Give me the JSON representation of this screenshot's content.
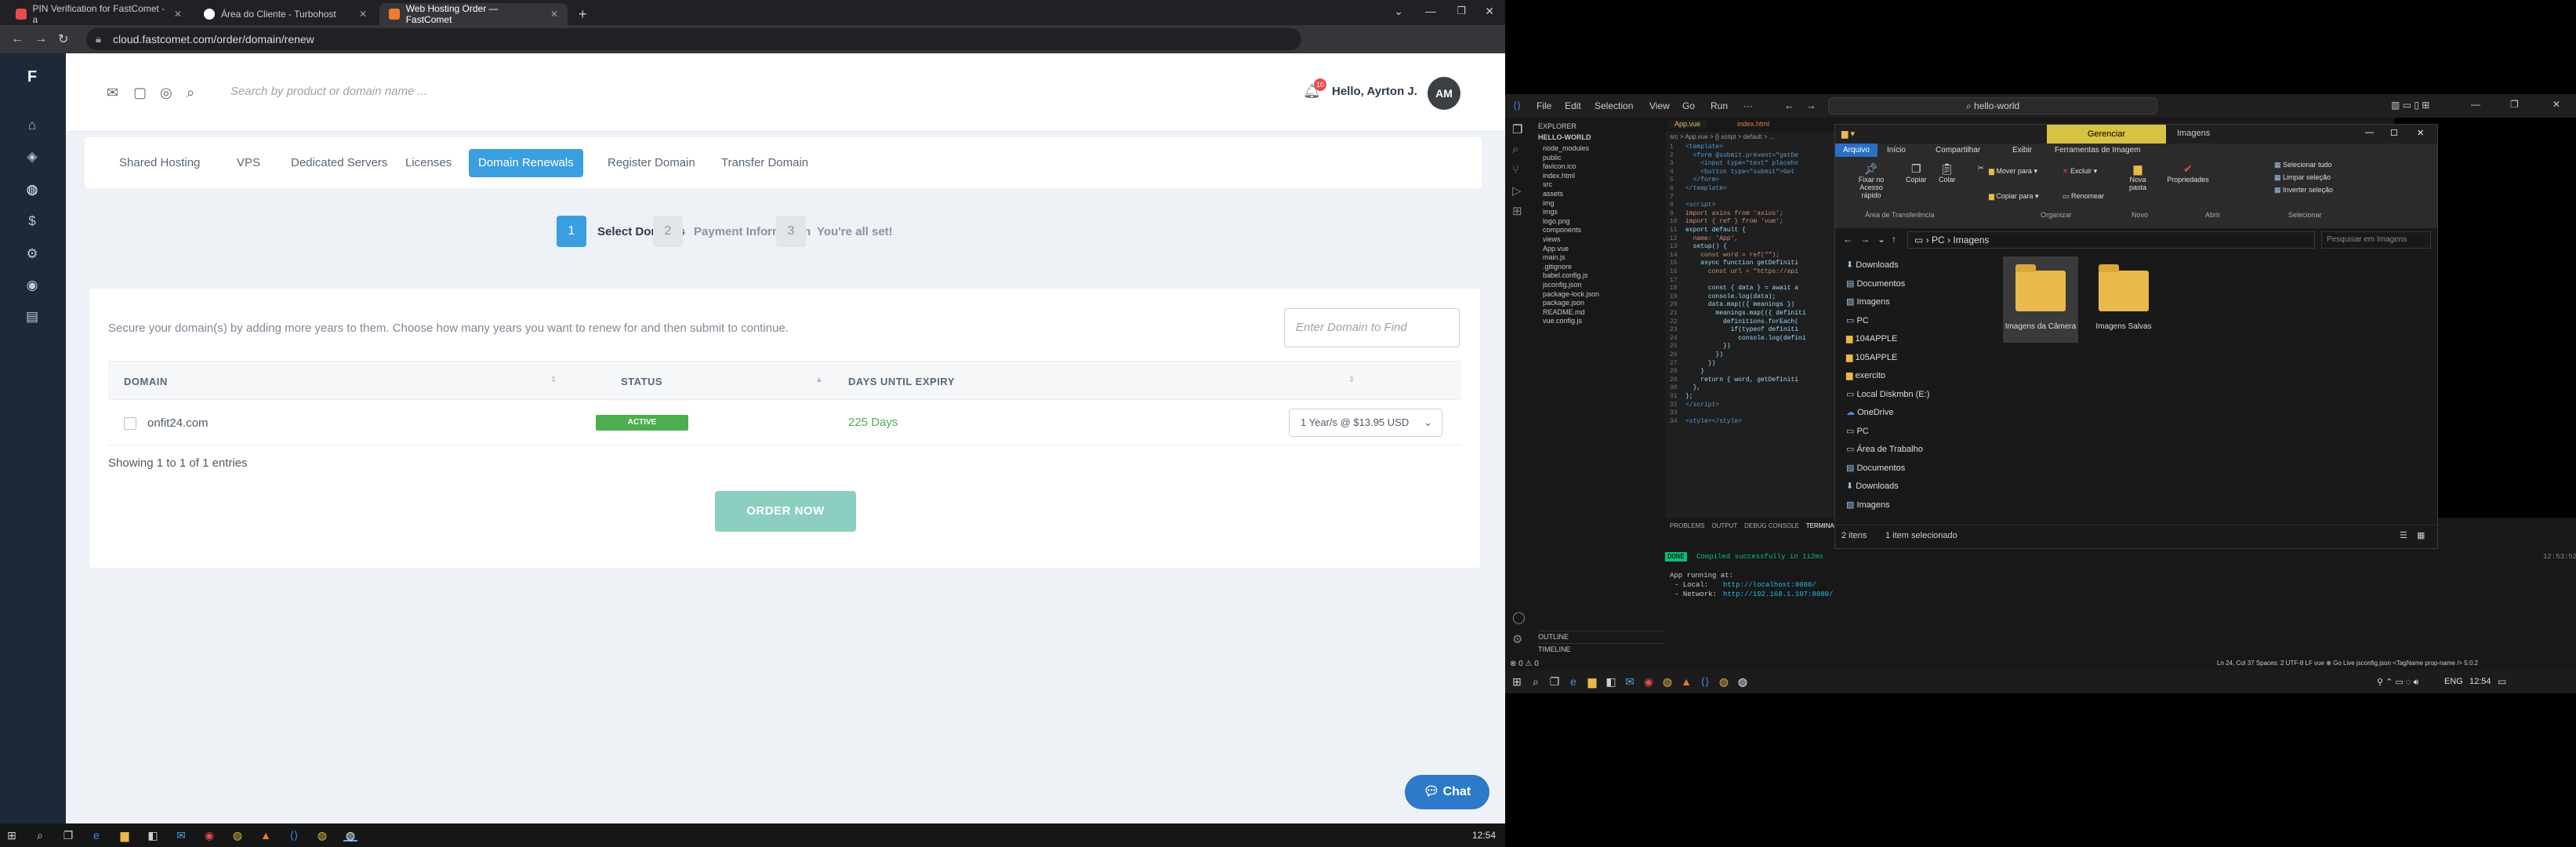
{
  "left": {
    "browser": {
      "tabs": [
        {
          "title": "PIN Verification for FastComet - a",
          "active": false,
          "fav_color": "#e94b4b"
        },
        {
          "title": "Área do Cliente - Turbohost",
          "active": false,
          "fav_color": "#ffffff"
        },
        {
          "title": "Web Hosting Order — FastComet",
          "active": true,
          "fav_color": "#f07a2f"
        }
      ],
      "new_tab": "+",
      "url": "cloud.fastcomet.com/order/domain/renew"
    },
    "app": {
      "search_placeholder": "Search by product or domain name ...",
      "notification_count": "10",
      "greeting": "Hello, Ayrton J.",
      "avatar_initials": "AM",
      "nav_tabs": [
        "Shared Hosting",
        "VPS",
        "Dedicated Servers",
        "Licenses",
        "Domain Renewals",
        "Register Domain",
        "Transfer Domain"
      ],
      "active_tab": "Domain Renewals",
      "steps": [
        {
          "num": "1",
          "label": "Select Domains",
          "active": true
        },
        {
          "num": "2",
          "label": "Payment Information",
          "active": false
        },
        {
          "num": "3",
          "label": "You're all set!",
          "active": false
        }
      ],
      "intro": "Secure your domain(s) by adding more years to them. Choose how many years you want to renew for and then submit to continue.",
      "find_placeholder": "Enter Domain to Find",
      "columns": [
        "DOMAIN",
        "STATUS",
        "DAYS UNTIL EXPIRY"
      ],
      "rows": [
        {
          "domain": "onfit24.com",
          "status": "ACTIVE",
          "days": "225 Days",
          "renewal": "1 Year/s @ $13.95 USD"
        }
      ],
      "entries": "Showing 1 to 1 of 1 entries",
      "order_button": "ORDER NOW",
      "chat_button": "Chat"
    },
    "taskbar_clock": "12:54"
  },
  "right": {
    "vscode": {
      "menu": [
        "File",
        "Edit",
        "Selection",
        "View",
        "Go",
        "Run",
        "···"
      ],
      "search": "hello-world",
      "explorer_title": "EXPLORER",
      "project": "HELLO-WORLD",
      "tree": [
        "node_modules",
        "public",
        "favicon.ico",
        "index.html",
        "src",
        "assets",
        "img",
        "imgs",
        "logo.png",
        "components",
        "views",
        "App.vue",
        "main.js",
        ".gitignore",
        "babel.config.js",
        "jsconfig.json",
        "package-lock.json",
        "package.json",
        "README.md",
        "vue.config.js"
      ],
      "tabs": [
        "App.vue",
        "index.html"
      ],
      "breadcrumb": "src > App.vue > {} script > default > ...",
      "code_lines": [
        "<template>",
        "  <form @submit.prevent=\"getDe",
        "    <input type=\"text\" placeho",
        "    <button type=\"submit\">Get",
        "  </form>",
        "</template>",
        "",
        "<script>",
        "import axios from 'axios';",
        "import { ref } from 'vue';",
        "export default {",
        "  name: 'App',",
        "  setup() {",
        "    const word = ref(\"\");",
        "    async function getDefiniti",
        "      const url = \"https://api",
        "",
        "      const { data } = await a",
        "      console.log(data);",
        "      data.map(({ meanings }) ",
        "        meanings.map(({ definiti",
        "          definitions.forEach(",
        "            if(typeof definiti",
        "              console.log(defini",
        "          })",
        "        })",
        "      })",
        "    }",
        "    return { word, getDefiniti",
        "  },",
        "};",
        "</script>",
        "",
        "<style></style>"
      ],
      "panel_tabs": [
        "PROBLEMS",
        "OUTPUT",
        "DEBUG CONSOLE",
        "TERMINAL"
      ],
      "terminal": {
        "done": "DONE",
        "compiled": "Compiled successfully in 112ms",
        "time": "12:53:52",
        "running": "App running at:",
        "local_label": "- Local:",
        "local_url": "http://localhost:8080/",
        "network_label": "- Network:",
        "network_url": "http://192.168.1.107:8080/"
      },
      "outline": "OUTLINE",
      "timeline": "TIMELINE",
      "status_left": "⊗ 0 ⚠ 0",
      "status_right": "Ln 24, Col 37   Spaces: 2   UTF-8   LF   vue   ⊕ Go Live   jsconfig.json   <TagName prop-name />   5.0.2"
    },
    "explorer": {
      "manage_tab": "Gerenciar",
      "title": "Imagens",
      "ribbon_tabs": [
        "Arquivo",
        "Início",
        "Compartilhar",
        "Exibir",
        "Ferramentas de Imagem"
      ],
      "ribbon_buttons": [
        "Fixar no Acesso rápido",
        "Copiar",
        "Colar",
        "Mover para",
        "Copiar para",
        "Excluir",
        "Renomear",
        "Nova pasta",
        "Propriedades",
        "Selecionar tudo",
        "Limpar seleção",
        "Inverter seleção"
      ],
      "groups": [
        "Área de Transferência",
        "Organizar",
        "Novo",
        "Abrir",
        "Selecionar"
      ],
      "path": [
        "PC",
        "Imagens"
      ],
      "search_placeholder": "Pesquisar em Imagens",
      "nav": [
        "Downloads",
        "Documentos",
        "Imagens",
        "PC",
        "104APPLE",
        "105APPLE",
        "exercito",
        "Local Diskmbn (E:)",
        "OneDrive",
        "PC",
        "Área de Trabalho",
        "Documentos",
        "Downloads",
        "Imagens"
      ],
      "folders": [
        "Imagens da Câmera",
        "Imagens Salvas"
      ],
      "status": [
        "2 itens",
        "1 item selecionado"
      ]
    },
    "taskbar": {
      "lang": "ENG",
      "clock": "12:54"
    }
  }
}
